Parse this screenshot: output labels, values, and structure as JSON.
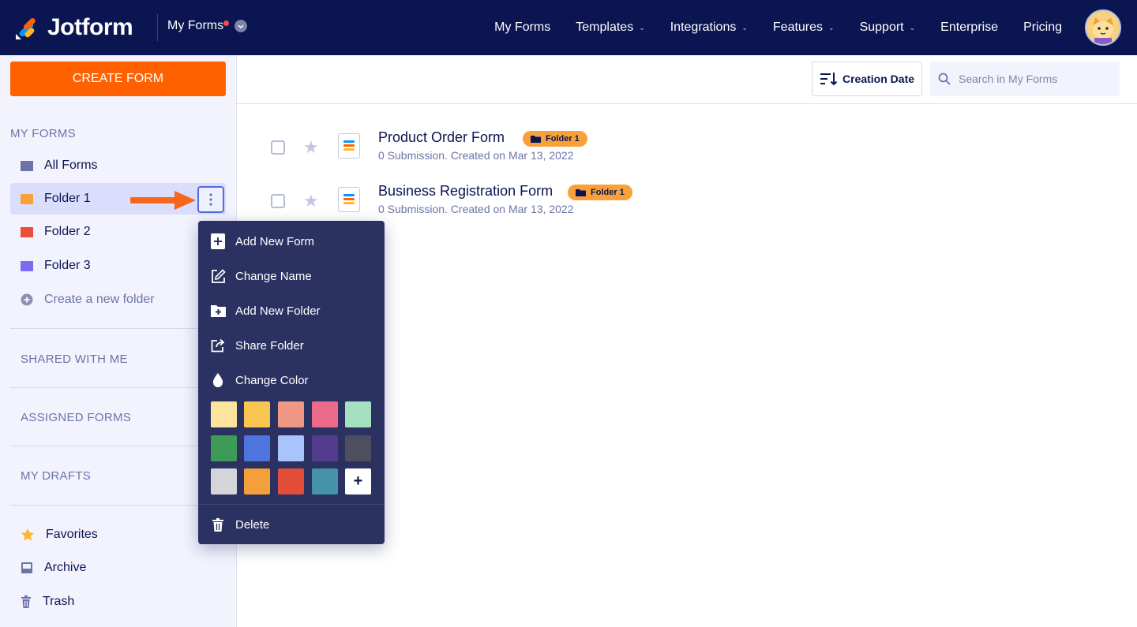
{
  "app": {
    "name": "Jotform",
    "switch_label": "My Forms"
  },
  "nav": [
    "My Forms",
    "Templates",
    "Integrations",
    "Features",
    "Support",
    "Enterprise",
    "Pricing"
  ],
  "sidebar": {
    "create_label": "CREATE FORM",
    "section_title": "MY FORMS",
    "items": [
      {
        "label": "All Forms",
        "color": "#6c73a8"
      },
      {
        "label": "Folder 1",
        "color": "#f8a13b"
      },
      {
        "label": "Folder 2",
        "color": "#e94e39"
      },
      {
        "label": "Folder 3",
        "color": "#7b6cf0"
      }
    ],
    "create_folder": "Create a new folder",
    "groups": [
      "SHARED WITH ME",
      "ASSIGNED FORMS",
      "MY DRAFTS"
    ],
    "bottom": [
      "Favorites",
      "Archive",
      "Trash"
    ]
  },
  "toolbar": {
    "sort_label": "Creation Date",
    "search_placeholder": "Search in My Forms"
  },
  "forms": [
    {
      "title": "Product Order Form",
      "meta": "0 Submission. Created on Mar 13, 2022",
      "folder": "Folder 1"
    },
    {
      "title": "Business Registration Form",
      "meta": "0 Submission. Created on Mar 13, 2022",
      "folder": "Folder 1"
    }
  ],
  "menu": {
    "items": [
      "Add New Form",
      "Change Name",
      "Add New Folder",
      "Share Folder",
      "Change Color"
    ],
    "delete_label": "Delete",
    "swatches": [
      "#fde49c",
      "#f8c752",
      "#ef9886",
      "#ec6a8a",
      "#a5e0c0",
      "#3d9a57",
      "#4e74dd",
      "#a9c4fc",
      "#533c8e",
      "#4d4f5e",
      "#d5d5d9",
      "#f4a03a",
      "#e24e3a",
      "#4493a9"
    ]
  }
}
